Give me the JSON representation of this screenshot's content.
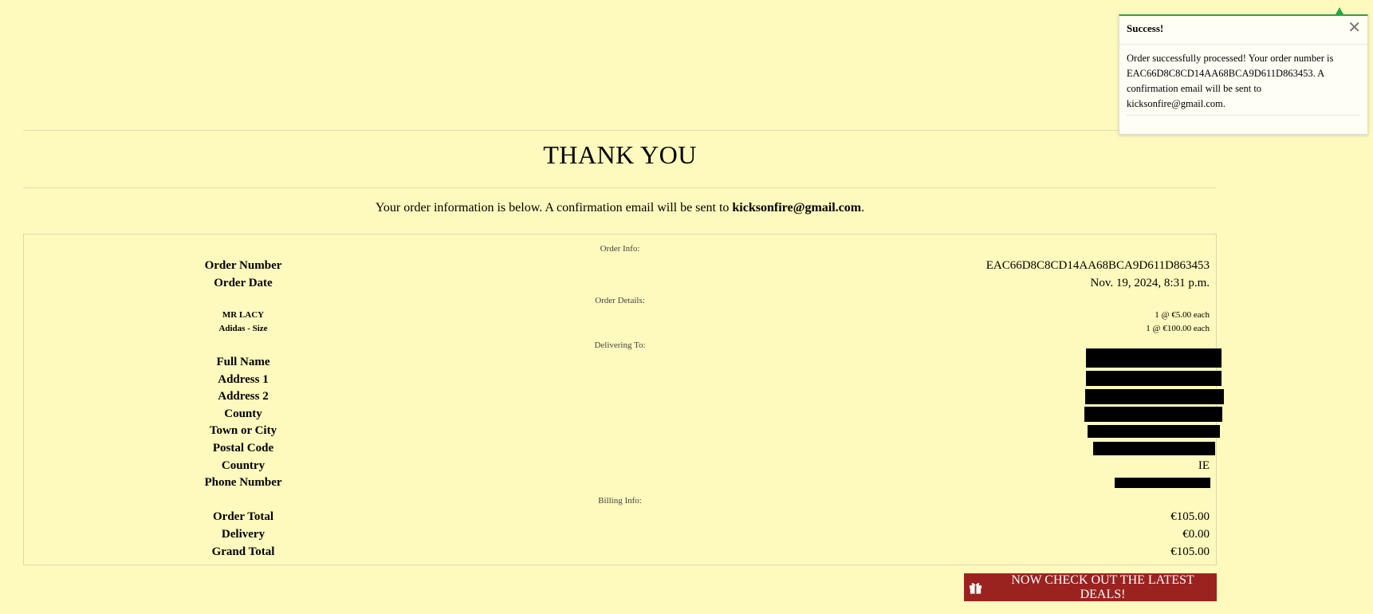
{
  "page": {
    "title": "THANK YOU",
    "subtitle_prefix": "Your order information is below. A confirmation email will be sent to ",
    "email": "kicksonfire@gmail.com",
    "subtitle_suffix": "."
  },
  "order_info": {
    "heading": "Order Info:",
    "rows": [
      {
        "label": "Order Number",
        "value": "EAC66D8C8CD14AA68BCA9D611D863453"
      },
      {
        "label": "Order Date",
        "value": "Nov. 19, 2024, 8:31 p.m."
      }
    ]
  },
  "order_details": {
    "heading": "Order Details:",
    "items": [
      {
        "name": "MR LACY",
        "qty_price": "1 @ €5.00 each"
      },
      {
        "name": "Adidas - Size",
        "qty_price": "1 @ €100.00 each"
      }
    ]
  },
  "delivering_to": {
    "heading": "Delivering To:",
    "rows": [
      {
        "label": "Full Name",
        "value": ""
      },
      {
        "label": "Address 1",
        "value": ""
      },
      {
        "label": "Address 2",
        "value": ""
      },
      {
        "label": "County",
        "value": ""
      },
      {
        "label": "Town or City",
        "value": ""
      },
      {
        "label": "Postal Code",
        "value": ""
      },
      {
        "label": "Country",
        "value": "IE"
      },
      {
        "label": "Phone Number",
        "value": ""
      }
    ]
  },
  "billing_info": {
    "heading": "Billing Info:",
    "rows": [
      {
        "label": "Order Total",
        "value": "€105.00"
      },
      {
        "label": "Delivery",
        "value": "€0.00"
      },
      {
        "label": "Grand Total",
        "value": "€105.00"
      }
    ]
  },
  "deals_button": {
    "label": "NOW CHECK OUT THE LATEST DEALS!",
    "icon": "gift-icon"
  },
  "toast": {
    "title": "Success!",
    "message": "Order successfully processed! Your order number is EAC66D8C8CD14AA68BCA9D611D863453. A confirmation email will be sent to kicksonfire@gmail.com.",
    "accent_color": "#28a745"
  },
  "colors": {
    "background": "#fef9bd",
    "button": "#9a2320"
  }
}
